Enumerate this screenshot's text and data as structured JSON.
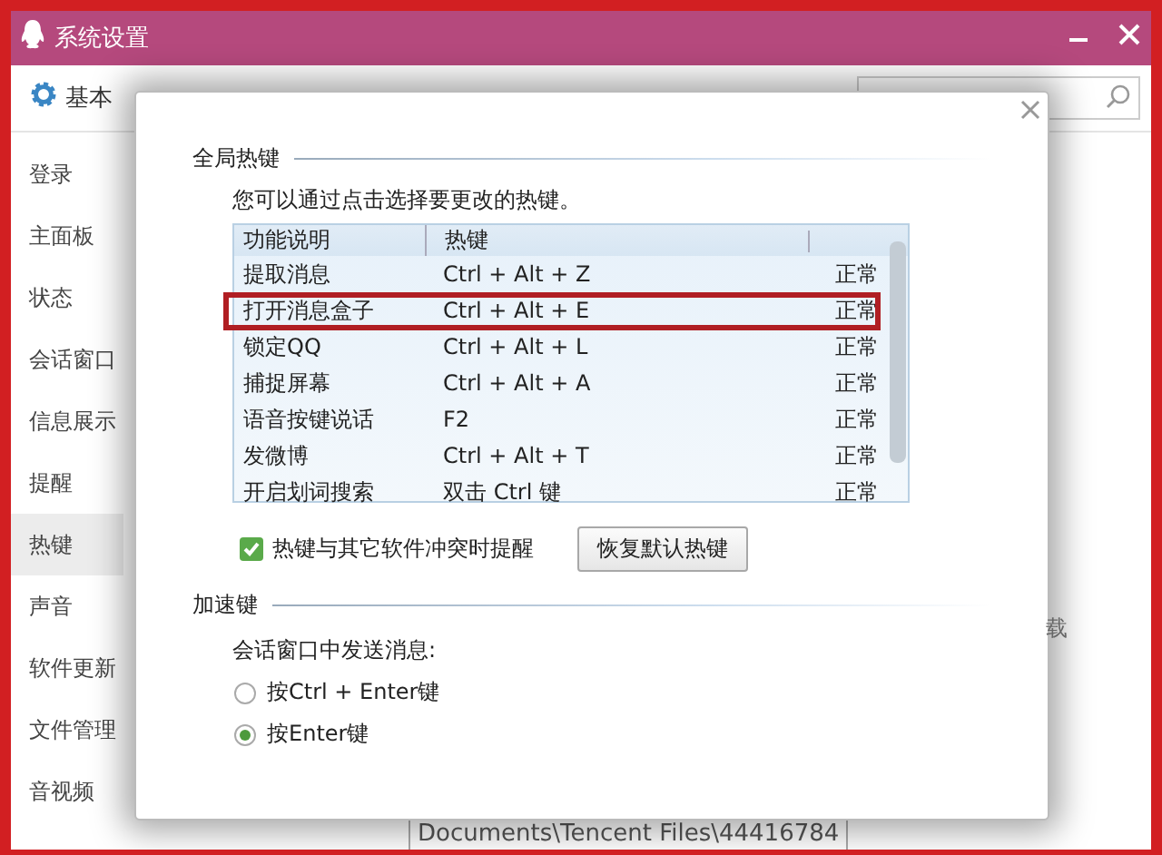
{
  "window": {
    "title": "系统设置"
  },
  "toolbar": {
    "tab": "基本"
  },
  "sidebar": {
    "items": [
      {
        "label": "登录",
        "selected": false
      },
      {
        "label": "主面板",
        "selected": false
      },
      {
        "label": "状态",
        "selected": false
      },
      {
        "label": "会话窗口",
        "selected": false
      },
      {
        "label": "信息展示",
        "selected": false
      },
      {
        "label": "提醒",
        "selected": false
      },
      {
        "label": "热键",
        "selected": true
      },
      {
        "label": "声音",
        "selected": false
      },
      {
        "label": "软件更新",
        "selected": false
      },
      {
        "label": "文件管理",
        "selected": false
      },
      {
        "label": "音视频",
        "selected": false
      }
    ]
  },
  "background": {
    "side_text": "载",
    "path": "Documents\\Tencent Files\\44416784"
  },
  "dialog": {
    "global_hotkeys": {
      "title": "全局热键",
      "hint": "您可以通过点击选择要更改的热键。",
      "columns": [
        "功能说明",
        "热键"
      ],
      "rows": [
        {
          "name": "提取消息",
          "hotkey": "Ctrl + Alt + Z",
          "status": "正常",
          "highlighted": false
        },
        {
          "name": "打开消息盒子",
          "hotkey": "Ctrl + Alt + E",
          "status": "正常",
          "highlighted": true
        },
        {
          "name": "锁定QQ",
          "hotkey": "Ctrl + Alt + L",
          "status": "正常",
          "highlighted": false
        },
        {
          "name": "捕捉屏幕",
          "hotkey": "Ctrl + Alt + A",
          "status": "正常",
          "highlighted": false
        },
        {
          "name": "语音按键说话",
          "hotkey": "F2",
          "status": "正常",
          "highlighted": false
        },
        {
          "name": "发微博",
          "hotkey": "Ctrl + Alt + T",
          "status": "正常",
          "highlighted": false
        },
        {
          "name": "开启划词搜索",
          "hotkey": "双击 Ctrl 键",
          "status": "正常",
          "highlighted": false
        }
      ],
      "conflict_alert": {
        "label": "热键与其它软件冲突时提醒",
        "checked": true
      },
      "restore_button": "恢复默认热键"
    },
    "accelerator": {
      "title": "加速键",
      "label": "会话窗口中发送消息:",
      "options": [
        {
          "label": "按Ctrl + Enter键",
          "selected": false
        },
        {
          "label": "按Enter键",
          "selected": true
        }
      ]
    }
  }
}
